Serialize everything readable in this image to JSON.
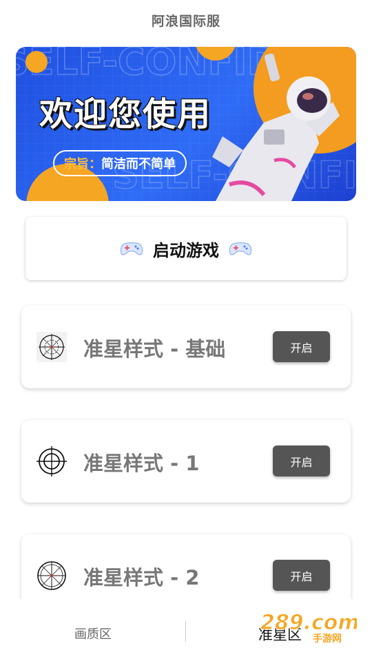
{
  "app": {
    "title": "阿浪国际服"
  },
  "banner": {
    "title": "欢迎您使用",
    "motto_prefix": "宗旨：",
    "motto_text": "简洁而不简单",
    "bg_text": "SELF-CONFIDENCE"
  },
  "start_game": {
    "label": "启动游戏",
    "icon": "gamepad-icon"
  },
  "crosshairs": [
    {
      "name": "准星样式 - 基础",
      "button": "开启",
      "icon": "crosshair-basic-icon"
    },
    {
      "name": "准星样式 - 1",
      "button": "开启",
      "icon": "crosshair-1-icon"
    },
    {
      "name": "准星样式 - 2",
      "button": "开启",
      "icon": "crosshair-2-icon"
    }
  ],
  "nav": {
    "left": "画质区",
    "right": "准星区"
  },
  "watermark": {
    "text": "289.com",
    "sub": "手游网"
  },
  "colors": {
    "banner_blue": "#2f6cf6",
    "button_gray": "#555555",
    "accent_orange": "#f5a623"
  }
}
